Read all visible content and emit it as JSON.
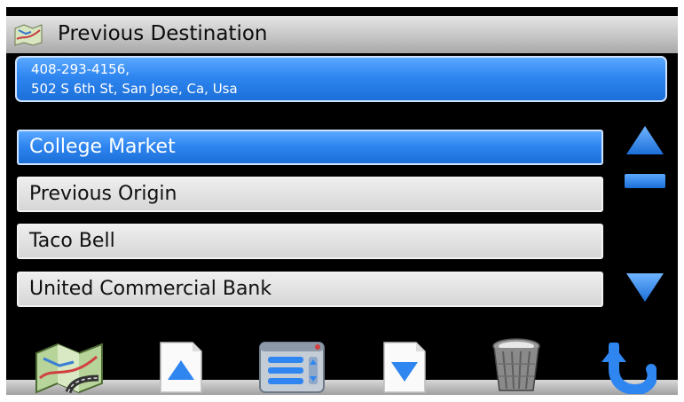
{
  "title": {
    "text": "Previous Destination",
    "icon": "map-icon"
  },
  "address": {
    "line1": "408-293-4156,",
    "line2": "502 S 6th St, San Jose, Ca, Usa"
  },
  "list": {
    "items": [
      {
        "label": "College Market",
        "selected": true
      },
      {
        "label": "Previous Origin",
        "selected": false
      },
      {
        "label": "Taco Bell",
        "selected": false
      },
      {
        "label": "United Commercial Bank",
        "selected": false
      }
    ]
  },
  "scrollbar": {
    "up_icon": "triangle-up-icon",
    "down_icon": "triangle-down-icon"
  },
  "toolbar": {
    "buttons": [
      "map-icon",
      "page-up-icon",
      "menu-list-icon",
      "page-down-icon",
      "trash-icon",
      "back-arrow-icon"
    ]
  },
  "colors": {
    "accent_blue": "#2f86f0",
    "background": "#000000",
    "item_gray": "#d6d6d6"
  }
}
